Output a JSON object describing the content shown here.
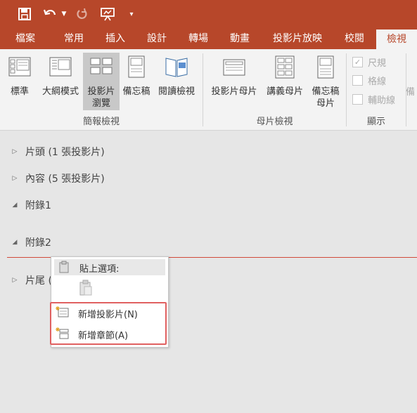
{
  "qat": {
    "save_icon": "save-icon",
    "undo_icon": "undo-icon",
    "redo_icon": "redo-icon",
    "present_icon": "present-from-start-icon",
    "customize_icon": "customize-qat-icon"
  },
  "tabs": [
    "檔案",
    "常用",
    "插入",
    "設計",
    "轉場",
    "動畫",
    "投影片放映",
    "校閱",
    "檢視"
  ],
  "active_tab": "檢視",
  "ribbon": {
    "presentation_views": {
      "buttons": [
        "標準",
        "大綱模式",
        "投影片",
        "瀏覽",
        "備忘稿",
        "閱讀檢視"
      ],
      "label": "簡報檢視"
    },
    "master_views": {
      "buttons": [
        "投影片母片",
        "講義母片",
        "備忘稿",
        "母片"
      ],
      "label": "母片檢視"
    },
    "show": {
      "options": [
        "尺規",
        "格線",
        "輔助線"
      ],
      "checked": [
        true,
        false,
        false
      ],
      "label": "顯示"
    },
    "cutoff": "備"
  },
  "sections": [
    {
      "text": "片頭 (1 張投影片)",
      "expanded": false
    },
    {
      "text": "內容 (5 張投影片)",
      "expanded": false
    },
    {
      "text": "附錄1",
      "expanded": true
    },
    {
      "text": "附錄2",
      "expanded": true
    },
    {
      "text": "片尾 (",
      "expanded": false
    }
  ],
  "context_menu": {
    "paste_header": "貼上選項:",
    "paste_icon": "paste-icon",
    "items": [
      {
        "label": "新增投影片(N)",
        "icon": "new-slide-icon"
      },
      {
        "label": "新增章節(A)",
        "icon": "new-section-icon"
      }
    ]
  },
  "colors": {
    "accent": "#b7472a",
    "highlight": "#e06060",
    "background": "#e6e6e6"
  }
}
